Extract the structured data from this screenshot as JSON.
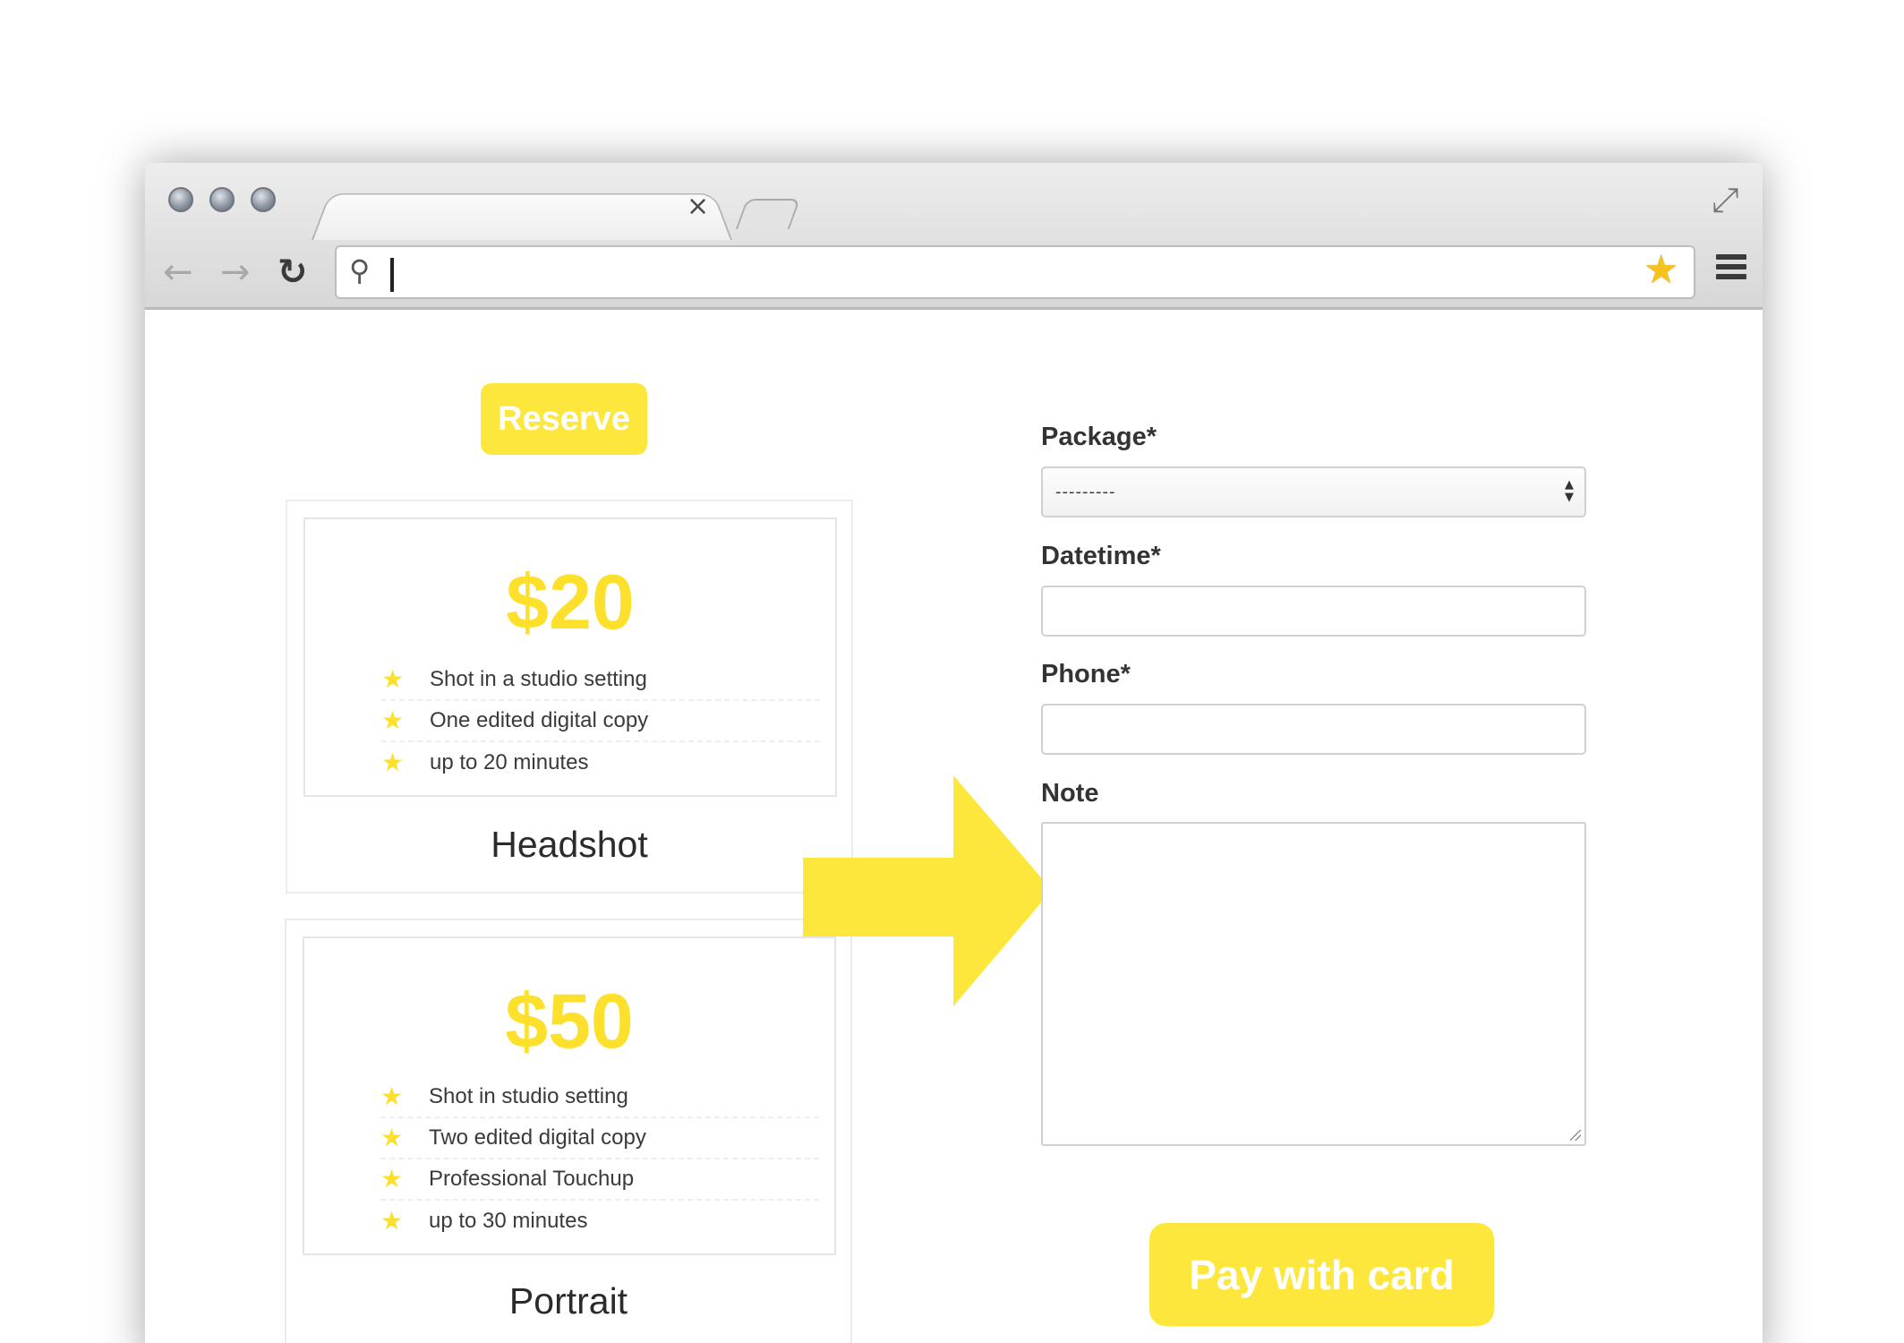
{
  "browser": {
    "tab_close": "×",
    "url_text": "",
    "icons": [
      "back-arrow-icon",
      "forward-arrow-icon",
      "reload-icon",
      "search-icon",
      "star-icon",
      "menu-icon",
      "expand-icon"
    ]
  },
  "page": {
    "reserve_label": "Reserve",
    "packages": [
      {
        "price": "$20",
        "features": [
          "Shot in a studio setting",
          "One edited digital copy",
          "up to 20 minutes"
        ],
        "name": "Headshot"
      },
      {
        "price": "$50",
        "features": [
          "Shot in studio setting",
          "Two edited digital copy",
          "Professional Touchup",
          "up to 30 minutes"
        ],
        "name": "Portrait"
      }
    ],
    "form": {
      "package_label": "Package*",
      "package_value": "---------",
      "datetime_label": "Datetime*",
      "datetime_value": "",
      "phone_label": "Phone*",
      "phone_value": "",
      "note_label": "Note",
      "note_value": ""
    },
    "pay_label": "Pay with card"
  },
  "colors": {
    "accent_yellow": "#fde73d",
    "price_yellow": "#fde02b"
  }
}
